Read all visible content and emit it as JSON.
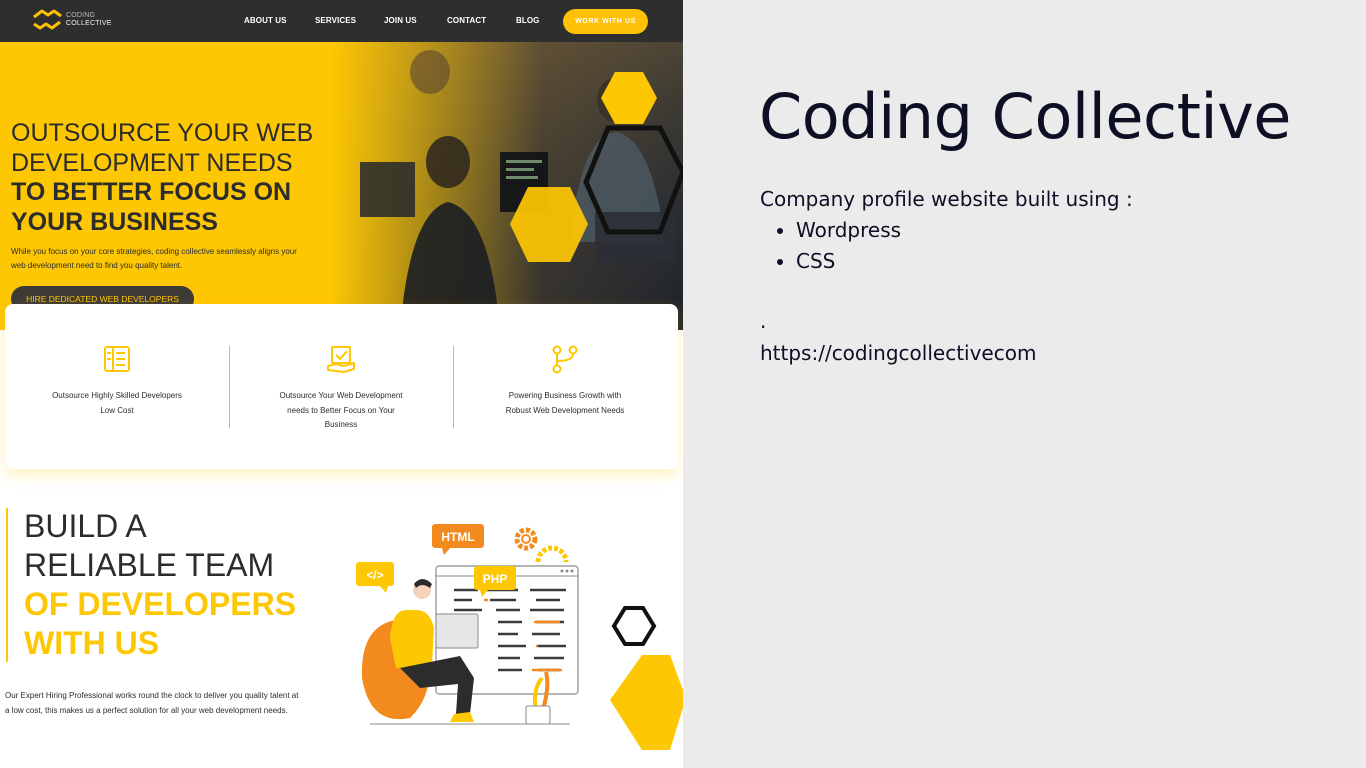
{
  "nav": {
    "logo": {
      "line1": "CODING",
      "line2": "COLLECTIVE"
    },
    "links": [
      "ABOUT US",
      "SERVICES",
      "JOIN US",
      "CONTACT",
      "BLOG"
    ],
    "cta": "WORK WITH US"
  },
  "hero": {
    "line1": "OUTSOURCE YOUR WEB",
    "line2": "DEVELOPMENT NEEDS",
    "line3": "TO BETTER FOCUS ON",
    "line4": "YOUR BUSINESS",
    "paragraph": "While you focus on your core strategies, coding collective seamlessly aligns your web development need to find you quality talent.",
    "button": "HIRE DEDICATED WEB DEVELOPERS"
  },
  "features": [
    {
      "icon": "document-list-icon",
      "text": "Outsource Highly Skilled Developers Low Cost"
    },
    {
      "icon": "hand-checklist-icon",
      "text": "Outsource Your Web Development needs to Better Focus on Your Business"
    },
    {
      "icon": "git-branch-icon",
      "text": "Powering Business Growth with Robust Web Development Needs"
    }
  ],
  "build": {
    "line1": "BUILD A",
    "line2": "RELIABLE TEAM",
    "line3": "OF DEVELOPERS",
    "line4": "WITH US",
    "paragraph": "Our Expert Hiring Professional works round the clock to deliver you quality talent at a low cost, this makes us a perfect solution for all your web development needs.",
    "badges": {
      "html": "HTML",
      "php": "PHP",
      "code": "</>"
    }
  },
  "panel": {
    "title": "Coding Collective",
    "description": "Company profile website built using :",
    "items": [
      "Wordpress",
      "CSS"
    ],
    "dot": ".",
    "url": "https://codingcollectivecom"
  },
  "colors": {
    "accent": "#fec703",
    "dark": "#2e2e2e",
    "text": "#0d0f24"
  }
}
